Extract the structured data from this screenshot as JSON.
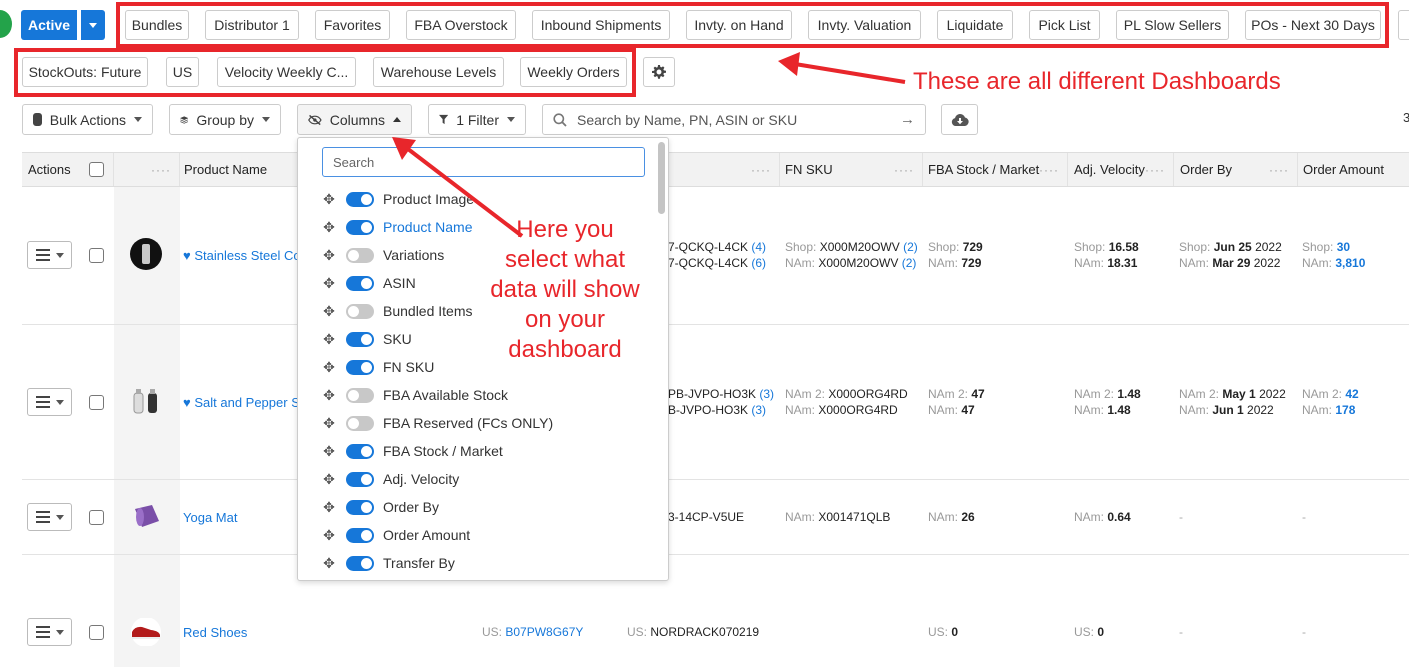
{
  "status_button": {
    "label": "Active"
  },
  "dashboards_row1": [
    "Bundles",
    "Distributor 1",
    "Favorites",
    "FBA Overstock",
    "Inbound Shipments",
    "Invty. on Hand",
    "Invty. Valuation",
    "Liquidate",
    "Pick List",
    "PL Slow Sellers",
    "POs - Next 30 Days"
  ],
  "dashboards_row2": [
    "StockOuts: Future",
    "US",
    "Velocity Weekly C...",
    "Warehouse Levels",
    "Weekly Orders"
  ],
  "toolbar": {
    "bulk_actions": "Bulk Actions",
    "group_by": "Group by",
    "columns": "Columns",
    "filter": "1 Filter",
    "search_placeholder": "Search by Name, PN, ASIN or SKU",
    "right_digit": "3"
  },
  "annotations": {
    "dashboards": "These are all different Dashboards",
    "columns_line1": "Here you",
    "columns_line2": "select what",
    "columns_line3": "data will show",
    "columns_line4": "on your",
    "columns_line5": "dashboard"
  },
  "table": {
    "headers": [
      "Actions",
      "Product Name",
      "FN SKU",
      "FBA Stock / Market",
      "Adj. Velocity",
      "Order By",
      "Order Amount"
    ],
    "rows": [
      {
        "name": "Stainless Steel Coc",
        "favorite": true,
        "sku_lines": [
          "7-QCKQ-L4CK",
          "(4)",
          "7-QCKQ-L4CK",
          "(6)"
        ],
        "fnsku": [
          [
            "Shop:",
            "X000M20OWV",
            "(2)"
          ],
          [
            "NAm:",
            "X000M20OWV",
            "(2)"
          ]
        ],
        "stock": [
          [
            "Shop:",
            "729"
          ],
          [
            "NAm:",
            "729"
          ]
        ],
        "velocity": [
          [
            "Shop:",
            "16.58"
          ],
          [
            "NAm:",
            "18.31"
          ]
        ],
        "order_by": [
          [
            "Shop:",
            "Jun 25",
            "2022"
          ],
          [
            "NAm:",
            "Mar 29",
            "2022"
          ]
        ],
        "order_amount": [
          [
            "Shop:",
            "30"
          ],
          [
            "NAm:",
            "3,810"
          ]
        ]
      },
      {
        "name": "Salt and Pepper Sh",
        "favorite": true,
        "sku_lines": [
          "PB-JVPO-HO3K",
          "(3)",
          "B-JVPO-HO3K",
          "(3)"
        ],
        "fnsku": [
          [
            "NAm 2:",
            "X000ORG4RD"
          ],
          [
            "NAm:",
            "X000ORG4RD"
          ]
        ],
        "stock": [
          [
            "NAm 2:",
            "47"
          ],
          [
            "NAm:",
            "47"
          ]
        ],
        "velocity": [
          [
            "NAm 2:",
            "1.48"
          ],
          [
            "NAm:",
            "1.48"
          ]
        ],
        "order_by": [
          [
            "NAm 2:",
            "May 1",
            "2022"
          ],
          [
            "NAm:",
            "Jun 1",
            "2022"
          ]
        ],
        "order_amount": [
          [
            "NAm 2:",
            "42"
          ],
          [
            "NAm:",
            "178"
          ]
        ]
      },
      {
        "name": "Yoga Mat",
        "sku": "3-14CP-V5UE",
        "fnsku": [
          [
            "NAm:",
            "X001471QLB"
          ]
        ],
        "stock": [
          [
            "NAm:",
            "26"
          ]
        ],
        "velocity": [
          [
            "NAm:",
            "0.64"
          ]
        ],
        "order_by": "-",
        "order_amount": "-"
      },
      {
        "name": "Red Shoes",
        "asin": [
          "US:",
          "B07PW8G67Y"
        ],
        "sku": [
          "US:",
          "NORDRACK070219"
        ],
        "stock": [
          [
            "US:",
            "0"
          ]
        ],
        "velocity": [
          [
            "US:",
            "0"
          ]
        ],
        "order_by": "-",
        "order_amount": "-"
      }
    ]
  },
  "columns_dropdown": {
    "search_placeholder": "Search",
    "items": [
      {
        "label": "Product Image",
        "on": true
      },
      {
        "label": "Product Name",
        "on": true
      },
      {
        "label": "Variations",
        "on": false
      },
      {
        "label": "ASIN",
        "on": true
      },
      {
        "label": "Bundled Items",
        "on": false
      },
      {
        "label": "SKU",
        "on": true
      },
      {
        "label": "FN SKU",
        "on": true
      },
      {
        "label": "FBA Available Stock",
        "on": false
      },
      {
        "label": "FBA Reserved (FCs ONLY)",
        "on": false
      },
      {
        "label": "FBA Stock / Market",
        "on": true
      },
      {
        "label": "Adj. Velocity",
        "on": true
      },
      {
        "label": "Order By",
        "on": true
      },
      {
        "label": "Order Amount",
        "on": true
      },
      {
        "label": "Transfer By",
        "on": true
      }
    ]
  },
  "colors": {
    "accent": "#1677d9",
    "annotation": "#e8262b",
    "status_green": "#23a34a"
  }
}
